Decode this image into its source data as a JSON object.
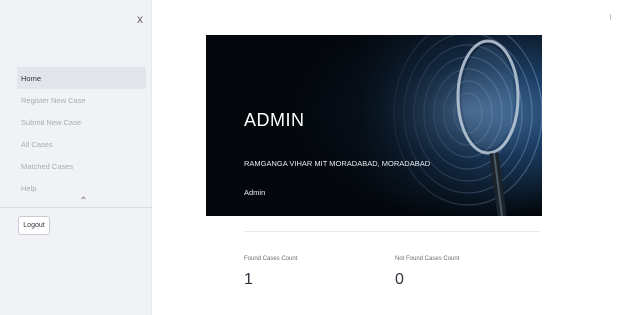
{
  "sidebar": {
    "close_label": "x",
    "items": [
      {
        "label": "Home",
        "active": true
      },
      {
        "label": "Register New Case",
        "active": false
      },
      {
        "label": "Submit New Case",
        "active": false
      },
      {
        "label": "All Cases",
        "active": false
      },
      {
        "label": "Matched Cases",
        "active": false
      },
      {
        "label": "Help",
        "active": false
      }
    ],
    "logout_label": "Logout"
  },
  "banner": {
    "title": "ADMIN",
    "address": "RAMGANGA VIHAR MIT MORADABAD, MORADABAD",
    "role": "Admin"
  },
  "metrics": [
    {
      "label": "Found Cases Count",
      "value": "1"
    },
    {
      "label": "Not Found Cases Count",
      "value": "0"
    }
  ],
  "colors": {
    "sidebar_bg": "#f0f2f6",
    "active_item_bg": "#e2e5ec",
    "banner_bg": "#03070c",
    "banner_accent": "#6a9bd0"
  }
}
